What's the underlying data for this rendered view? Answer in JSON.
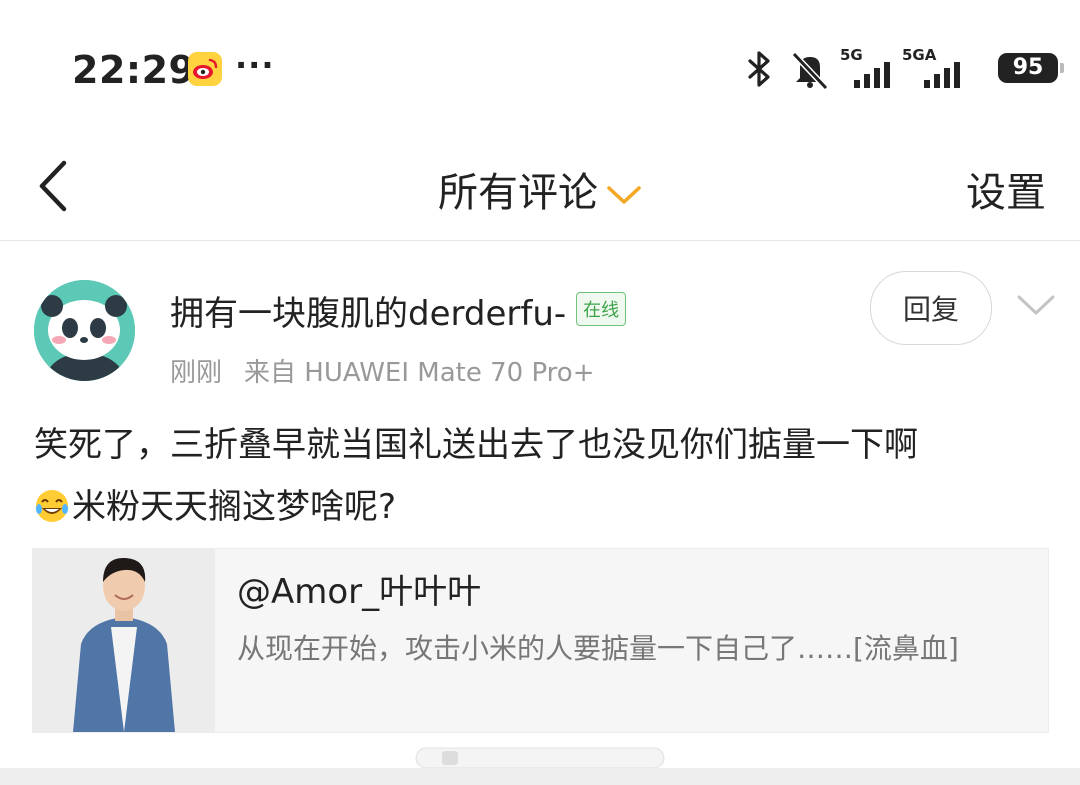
{
  "status_bar": {
    "time": "22:29",
    "more": "···",
    "network1": "5G",
    "network2": "5GA",
    "battery": "95"
  },
  "nav": {
    "title": "所有评论",
    "settings": "设置"
  },
  "comment": {
    "username": "拥有一块腹肌的derderfu-",
    "online_badge": "在线",
    "time": "刚刚",
    "source": "来自 HUAWEI Mate 70 Pro+",
    "reply_label": "回复",
    "text_part1": "笑死了，三折叠早就当国礼送出去了也没见你们掂量一下啊",
    "text_part2": "米粉天天搁这梦啥呢?"
  },
  "quote": {
    "author": "@Amor_叶叶叶",
    "text": "从现在开始，攻击小米的人要掂量一下自己了……[流鼻血]"
  },
  "colors": {
    "accent": "#f5a623",
    "online_green": "#3ea44c",
    "secondary_text": "#999999"
  },
  "icons": [
    "weibo-app-icon",
    "bluetooth-icon",
    "mute-icon",
    "signal-icon",
    "battery-icon",
    "back-icon",
    "chevron-down-icon",
    "laugh-cry-emoji-icon"
  ]
}
